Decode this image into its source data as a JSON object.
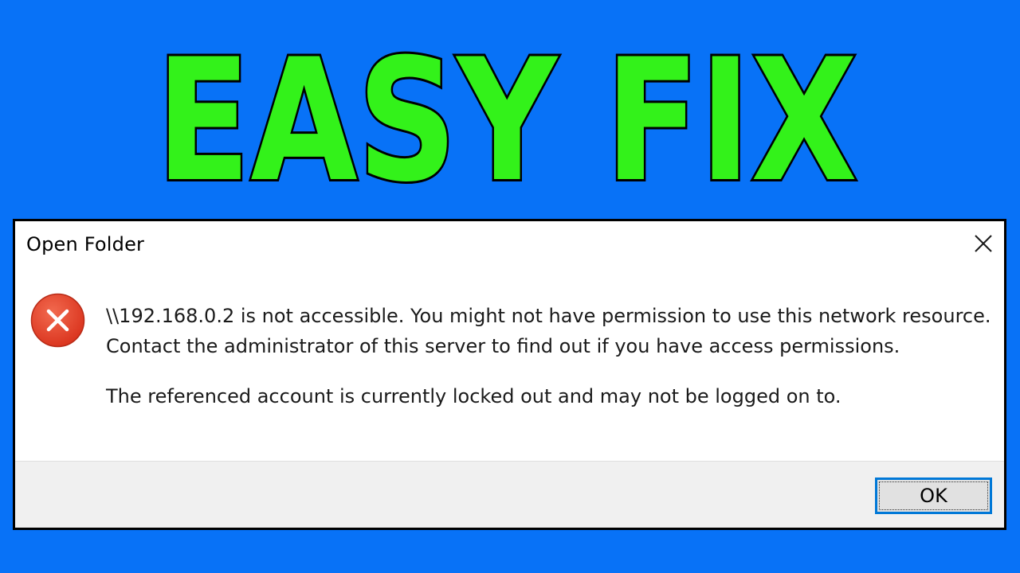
{
  "banner": {
    "text": "EASY FIX",
    "fill_color": "#33f21a",
    "outline_color": "#000000"
  },
  "dialog": {
    "title": "Open Folder",
    "close_icon": "close-icon",
    "error_icon": "error-icon",
    "error_color": "#e8412b",
    "message_lines": [
      "\\\\192.168.0.2 is not accessible. You might not have permission to use this network resource.",
      "Contact the administrator of this server to find out if you have access permissions.",
      "The referenced account is currently locked out and may not be logged on to."
    ],
    "ok_label": "OK",
    "focus_color": "#0078d7"
  },
  "colors": {
    "background": "#0872f7"
  }
}
